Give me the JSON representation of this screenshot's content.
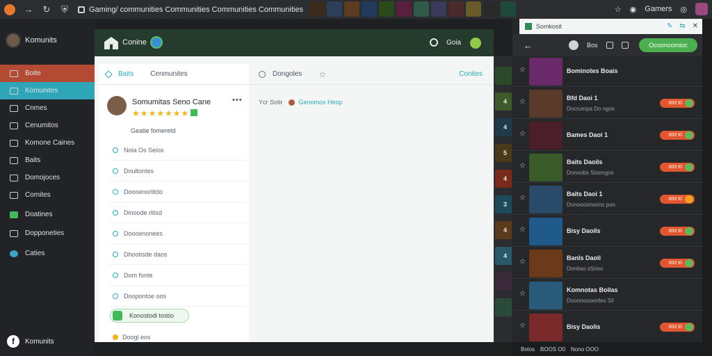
{
  "browser": {
    "url": "Gaming/ communities Communities Communities Communities",
    "user": "Gamers",
    "thumb_colors": [
      "#3a2a1a",
      "#2c3e58",
      "#5a3c20",
      "#1f3a5a",
      "#2a4a1a",
      "#5a1f3a",
      "#2f5a4a",
      "#3a3a5a",
      "#4a2a2a",
      "#6a5a2a",
      "#2a2a2a",
      "#1f4a3a"
    ]
  },
  "sidebar": {
    "brand": "Komunits",
    "items": [
      {
        "label": "Boite",
        "style": "red"
      },
      {
        "label": "Komunites",
        "style": "teal"
      },
      {
        "label": "Cnmes",
        "style": "plain"
      },
      {
        "label": "Cenumitos",
        "style": "plain"
      },
      {
        "label": "Komone Caines",
        "style": "plain"
      },
      {
        "label": "Baits",
        "style": "plain"
      },
      {
        "label": "Domojoces",
        "style": "plain"
      },
      {
        "label": "Comites",
        "style": "plain"
      },
      {
        "label": "Doatines",
        "style": "green"
      },
      {
        "label": "Dopponeties",
        "style": "plain"
      },
      {
        "label": "Caties",
        "style": "round"
      }
    ],
    "footer": "Komunits"
  },
  "main": {
    "header_title": "Conine",
    "user": "Goia",
    "tabs_left": [
      {
        "label": "Baits",
        "active": true
      },
      {
        "label": "Cenmunites",
        "active": false
      }
    ],
    "tab_right": "Dongoles",
    "tab_online": "Conites",
    "profile": {
      "name": "Somumitas Seno Cane",
      "stars": "★★★★★★★",
      "subtitle": "Geatie fomeretd"
    },
    "list": [
      "Noia Os Seios",
      "Dnultontes",
      "Doooenorlitdo",
      "Dinoode rlitsd",
      "Doooenonees",
      "Dhootisde daos",
      "Dom fonte",
      "Doopontoe oos"
    ],
    "pill_label": "Konostodi tostio",
    "bottom_label": "Doogl eos",
    "breadcrumb": {
      "prefix": "Ycr Sotir",
      "link": "Genomos Heop"
    }
  },
  "strip": {
    "cells": [
      {
        "color": "#2a4a2a",
        "num": ""
      },
      {
        "color": "#3f5a2a",
        "num": "4"
      },
      {
        "color": "#1f3a4a",
        "num": "4"
      },
      {
        "color": "#4a3a1a",
        "num": "5"
      },
      {
        "color": "#7a2a1a",
        "num": "4"
      },
      {
        "color": "#1f4a5a",
        "num": "3"
      },
      {
        "color": "#5a3a1a",
        "num": "4"
      },
      {
        "color": "#2a5a6a",
        "num": "4"
      },
      {
        "color": "#3a2a3a",
        "num": ""
      },
      {
        "color": "#2a4a3a",
        "num": ""
      }
    ]
  },
  "right_panel": {
    "top_label": "Somkosit",
    "back": "←",
    "user": "Bos",
    "button": "Ocoonoomioc",
    "games": [
      {
        "name": "Bominotes Boais",
        "sub": "",
        "color": "#6a2a6a",
        "pill": "",
        "pill_style": "none"
      },
      {
        "name": "Bfd Daoi 1",
        "sub": "Docrumpa Do ngos",
        "color": "#5a3a2a",
        "pill": "000 I0",
        "pill_style": "green"
      },
      {
        "name": "Bames Daoi 1",
        "sub": "",
        "color": "#4a1f2a",
        "pill": "000 I0",
        "pill_style": "green"
      },
      {
        "name": "Baits Daoils",
        "sub": "Donoobs Sioongos",
        "color": "#3a5a2a",
        "pill": "000 I0",
        "pill_style": "green"
      },
      {
        "name": "Baits Daoi 1",
        "sub": "Donoooonoons poo",
        "color": "#2a4a6a",
        "pill": "000 I0",
        "pill_style": "orange"
      },
      {
        "name": "Bisy Daoils",
        "sub": "",
        "color": "#1f5a8a",
        "pill": "000 I0",
        "pill_style": "green"
      },
      {
        "name": "Banls Daoli",
        "sub": "Dontiao sSrioo",
        "color": "#6a3a1a",
        "pill": "000 I0",
        "pill_style": "green"
      },
      {
        "name": "Komnotas Boilas",
        "sub": "Doonnoooonfes Sil",
        "color": "#2a5a7a",
        "pill": "",
        "pill_style": "none"
      },
      {
        "name": "Bisy Daolis",
        "sub": "",
        "color": "#7a2a2a",
        "pill": "000 I0",
        "pill_style": "green"
      }
    ],
    "footer": [
      "Bolos",
      "BOOS O0",
      "Nono OOO"
    ]
  }
}
